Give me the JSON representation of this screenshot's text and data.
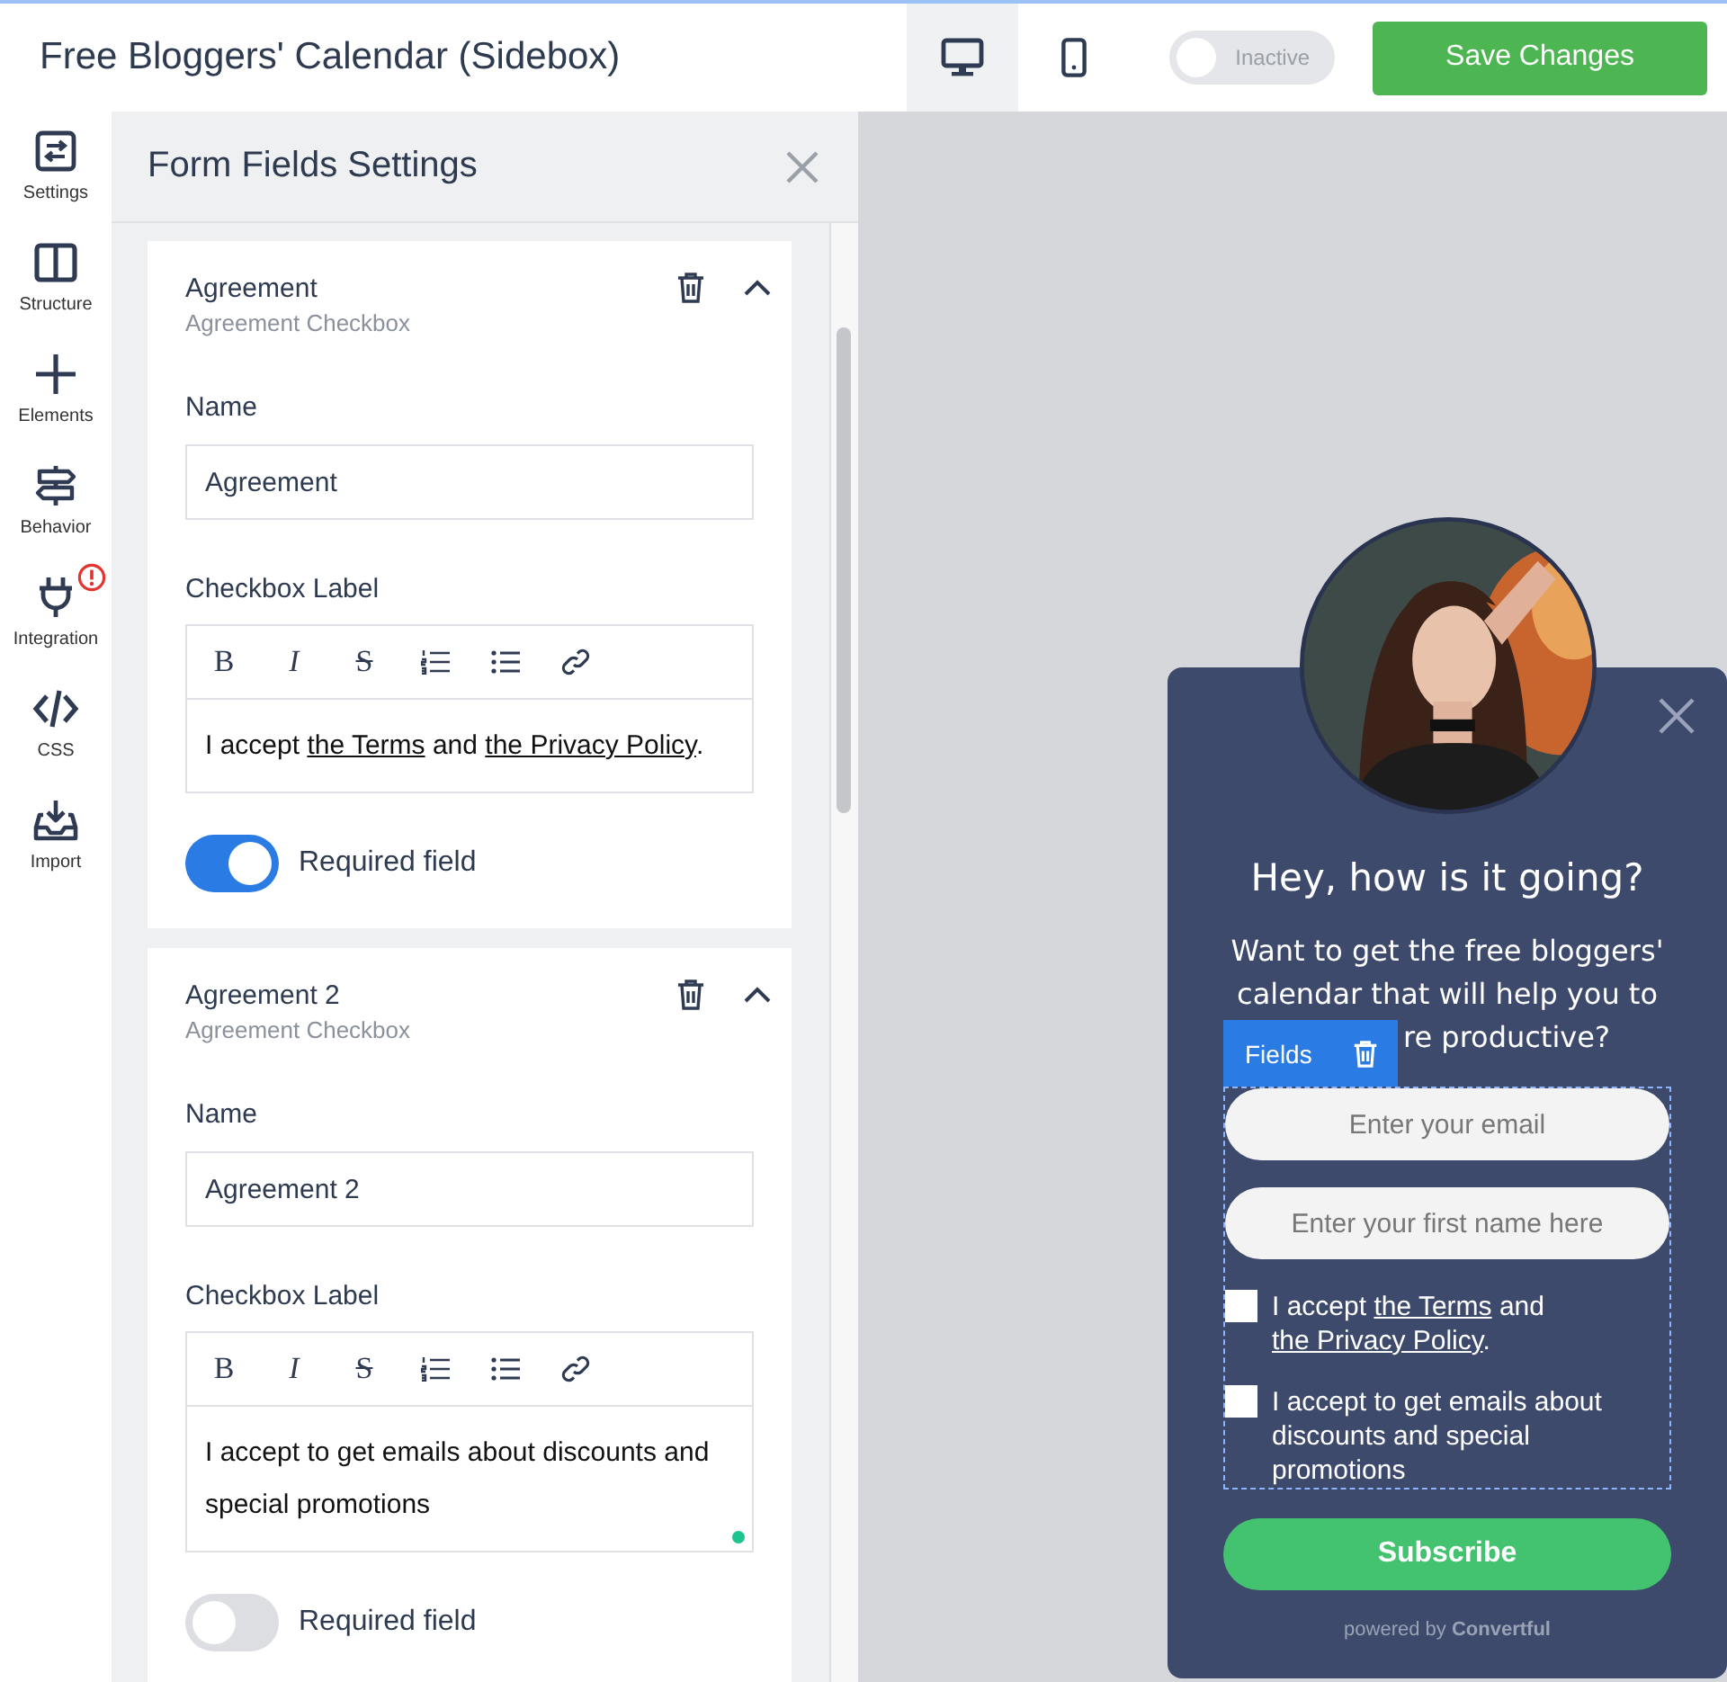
{
  "header": {
    "title": "Free Bloggers' Calendar (Sidebox)",
    "devices": [
      {
        "kind": "desktop",
        "selected": true
      },
      {
        "kind": "mobile",
        "selected": false
      }
    ],
    "status_toggle": {
      "label": "Inactive",
      "on": false
    },
    "save_button": "Save Changes"
  },
  "sidebar": {
    "items": [
      {
        "kind": "settings",
        "label": "Settings",
        "alert": false
      },
      {
        "kind": "structure",
        "label": "Structure",
        "alert": false
      },
      {
        "kind": "elements",
        "label": "Elements",
        "alert": false
      },
      {
        "kind": "behavior",
        "label": "Behavior",
        "alert": false
      },
      {
        "kind": "integration",
        "label": "Integration",
        "alert": true
      },
      {
        "kind": "css",
        "label": "CSS",
        "alert": false
      },
      {
        "kind": "import",
        "label": "Import",
        "alert": false
      }
    ]
  },
  "panel": {
    "title": "Form Fields Settings",
    "fields": [
      {
        "title": "Agreement",
        "subtitle": "Agreement Checkbox",
        "expanded": true,
        "name_label": "Name",
        "name_value": "Agreement",
        "checkbox_label_title": "Checkbox Label",
        "toolbar": [
          {
            "kind": "bold",
            "glyph": "B"
          },
          {
            "kind": "italic",
            "glyph": "I"
          },
          {
            "kind": "strike",
            "glyph": "S"
          },
          {
            "kind": "ordered_list"
          },
          {
            "kind": "bullet_list"
          },
          {
            "kind": "link"
          }
        ],
        "label_text": [
          {
            "text": "I accept ",
            "link": false
          },
          {
            "text": "the Terms",
            "link": true
          },
          {
            "text": " and ",
            "link": false
          },
          {
            "text": "the Privacy Policy",
            "link": true
          },
          {
            "text": ".",
            "link": false
          }
        ],
        "indicator": false,
        "required_label": "Required field",
        "required": true
      },
      {
        "title": "Agreement 2",
        "subtitle": "Agreement Checkbox",
        "expanded": true,
        "name_label": "Name",
        "name_value": "Agreement 2",
        "checkbox_label_title": "Checkbox Label",
        "toolbar": [
          {
            "kind": "bold",
            "glyph": "B"
          },
          {
            "kind": "italic",
            "glyph": "I"
          },
          {
            "kind": "strike",
            "glyph": "S"
          },
          {
            "kind": "ordered_list"
          },
          {
            "kind": "bullet_list"
          },
          {
            "kind": "link"
          }
        ],
        "label_text": [
          {
            "text": "I accept to get emails about discounts and special promotions",
            "link": false
          }
        ],
        "indicator": true,
        "required_label": "Required field",
        "required": false
      }
    ]
  },
  "preview": {
    "popup": {
      "heading": "Hey, how is it going?",
      "text_lines": [
        "Want to get the free bloggers'",
        "calendar that will help you to",
        "re productive?"
      ],
      "fields_tag": "Fields",
      "inputs": [
        {
          "placeholder": "Enter your email"
        },
        {
          "placeholder": "Enter your first name here"
        }
      ],
      "checkboxes": [
        {
          "checked": false,
          "segments": [
            {
              "text": "I accept ",
              "link": false
            },
            {
              "text": "the Terms",
              "link": true
            },
            {
              "text": " and ",
              "link": false
            },
            {
              "text": "the Privacy Policy",
              "link": true
            },
            {
              "text": ".",
              "link": false
            }
          ]
        },
        {
          "checked": false,
          "segments": [
            {
              "text": "I accept to get emails about discounts and special promotions",
              "link": false
            }
          ]
        }
      ],
      "submit": "Subscribe",
      "powered_by": "powered by **Convertful**"
    }
  }
}
